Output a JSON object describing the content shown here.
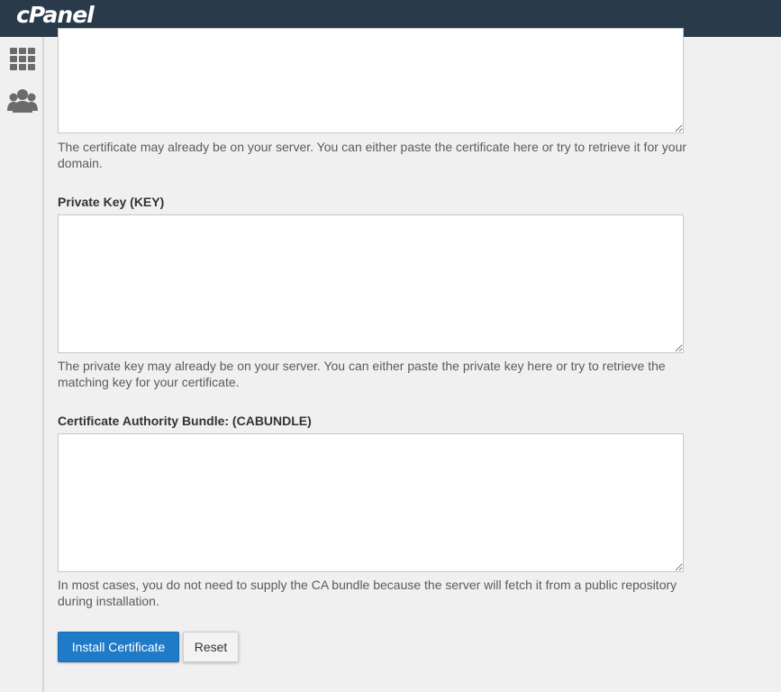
{
  "brand": {
    "logo_text": "cPanel"
  },
  "sidebar": {
    "items": [
      {
        "icon": "grid-icon"
      },
      {
        "icon": "users-icon"
      }
    ]
  },
  "form": {
    "certificate": {
      "value": "",
      "help": "The certificate may already be on your server. You can either paste the certificate here or try to retrieve it for your domain."
    },
    "private_key": {
      "label": "Private Key (KEY)",
      "value": "",
      "help": "The private key may already be on your server. You can either paste the private key here or try to retrieve the matching key for your certificate."
    },
    "cabundle": {
      "label": "Certificate Authority Bundle: (CABUNDLE)",
      "value": "",
      "help": "In most cases, you do not need to supply the CA bundle because the server will fetch it from a public repository during installation."
    },
    "install_label": "Install Certificate",
    "reset_label": "Reset"
  },
  "colors": {
    "topbar": "#293a4a",
    "primary_button": "#1f7ac8",
    "icon": "#6b6b6b"
  }
}
